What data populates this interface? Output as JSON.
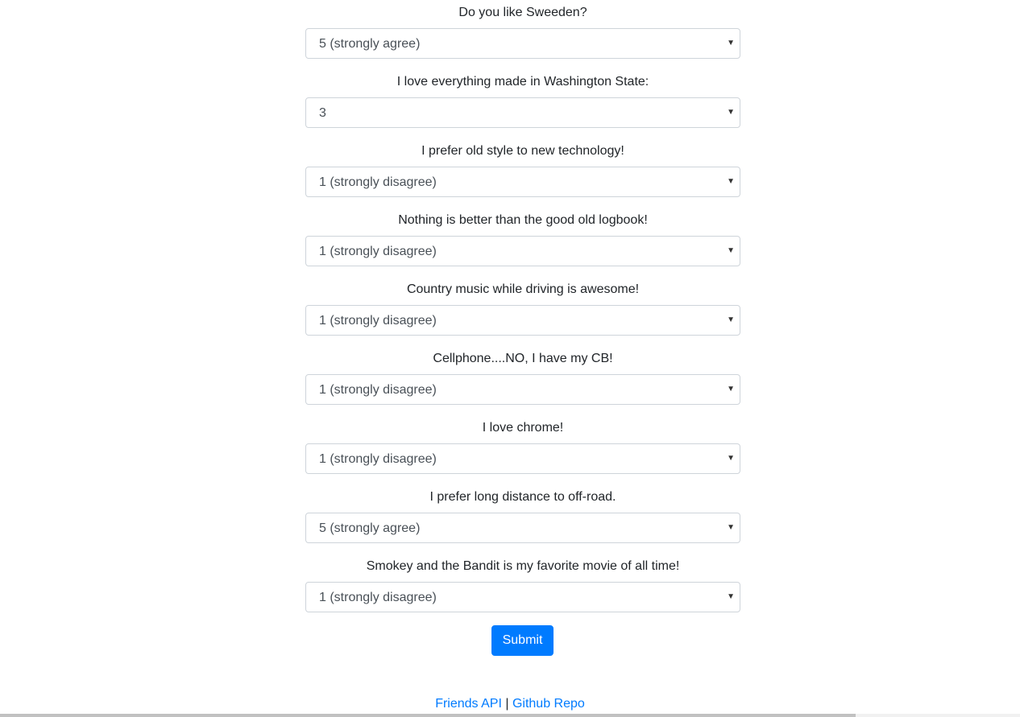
{
  "survey": {
    "questions": [
      {
        "label": "Do you like Sweeden?",
        "selected": "5 (strongly agree)"
      },
      {
        "label": "I love everything made in Washington State:",
        "selected": "3"
      },
      {
        "label": "I prefer old style to new technology!",
        "selected": "1 (strongly disagree)"
      },
      {
        "label": "Nothing is better than the good old logbook!",
        "selected": "1 (strongly disagree)"
      },
      {
        "label": "Country music while driving is awesome!",
        "selected": "1 (strongly disagree)"
      },
      {
        "label": "Cellphone....NO, I have my CB!",
        "selected": "1 (strongly disagree)"
      },
      {
        "label": "I love chrome!",
        "selected": "1 (strongly disagree)"
      },
      {
        "label": "I prefer long distance to off-road.",
        "selected": "5 (strongly agree)"
      },
      {
        "label": "Smokey and the Bandit is my favorite movie of all time!",
        "selected": "1 (strongly disagree)"
      }
    ],
    "dropdown_arrow": "▼",
    "submit_label": "Submit"
  },
  "footer": {
    "api_link": "Friends API",
    "separator": "|",
    "repo_link": "Github Repo"
  },
  "colors": {
    "primary": "#007bff",
    "text": "#212529",
    "select_text": "#495057",
    "border": "#ced4da"
  }
}
